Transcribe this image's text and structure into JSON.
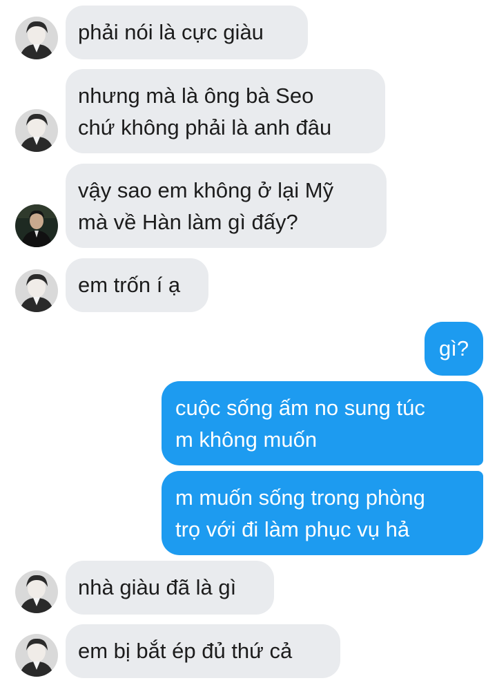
{
  "messages": [
    {
      "side": "in",
      "avatar": "avatar-a",
      "lines": [
        "phải nói là cực giàu"
      ]
    },
    {
      "side": "in",
      "avatar": "avatar-a",
      "lines": [
        "nhưng mà là ông bà Seo",
        "chứ không phải là anh đâu"
      ]
    },
    {
      "side": "in",
      "avatar": "avatar-b",
      "lines": [
        "vậy sao em không ở lại Mỹ",
        "mà về Hàn làm gì đấy?"
      ]
    },
    {
      "side": "in",
      "avatar": "avatar-a",
      "lines": [
        "em trốn í ạ"
      ]
    },
    {
      "side": "out",
      "lines": [
        "gì?"
      ]
    },
    {
      "side": "out",
      "lines": [
        "cuộc sống ấm no sung túc",
        "m không muốn"
      ]
    },
    {
      "side": "out",
      "lines": [
        "m muốn sống trong phòng",
        "trọ với đi làm phục vụ hả"
      ]
    },
    {
      "side": "in",
      "avatar": "avatar-a",
      "lines": [
        "nhà giàu đã là gì"
      ]
    },
    {
      "side": "in",
      "avatar": "avatar-a",
      "lines": [
        "em bị bắt ép đủ thứ cả"
      ]
    }
  ],
  "colors": {
    "incoming_bubble": "#e9ebee",
    "outgoing_bubble": "#1d9bf0",
    "incoming_text": "#1c1c1c",
    "outgoing_text": "#ffffff"
  }
}
